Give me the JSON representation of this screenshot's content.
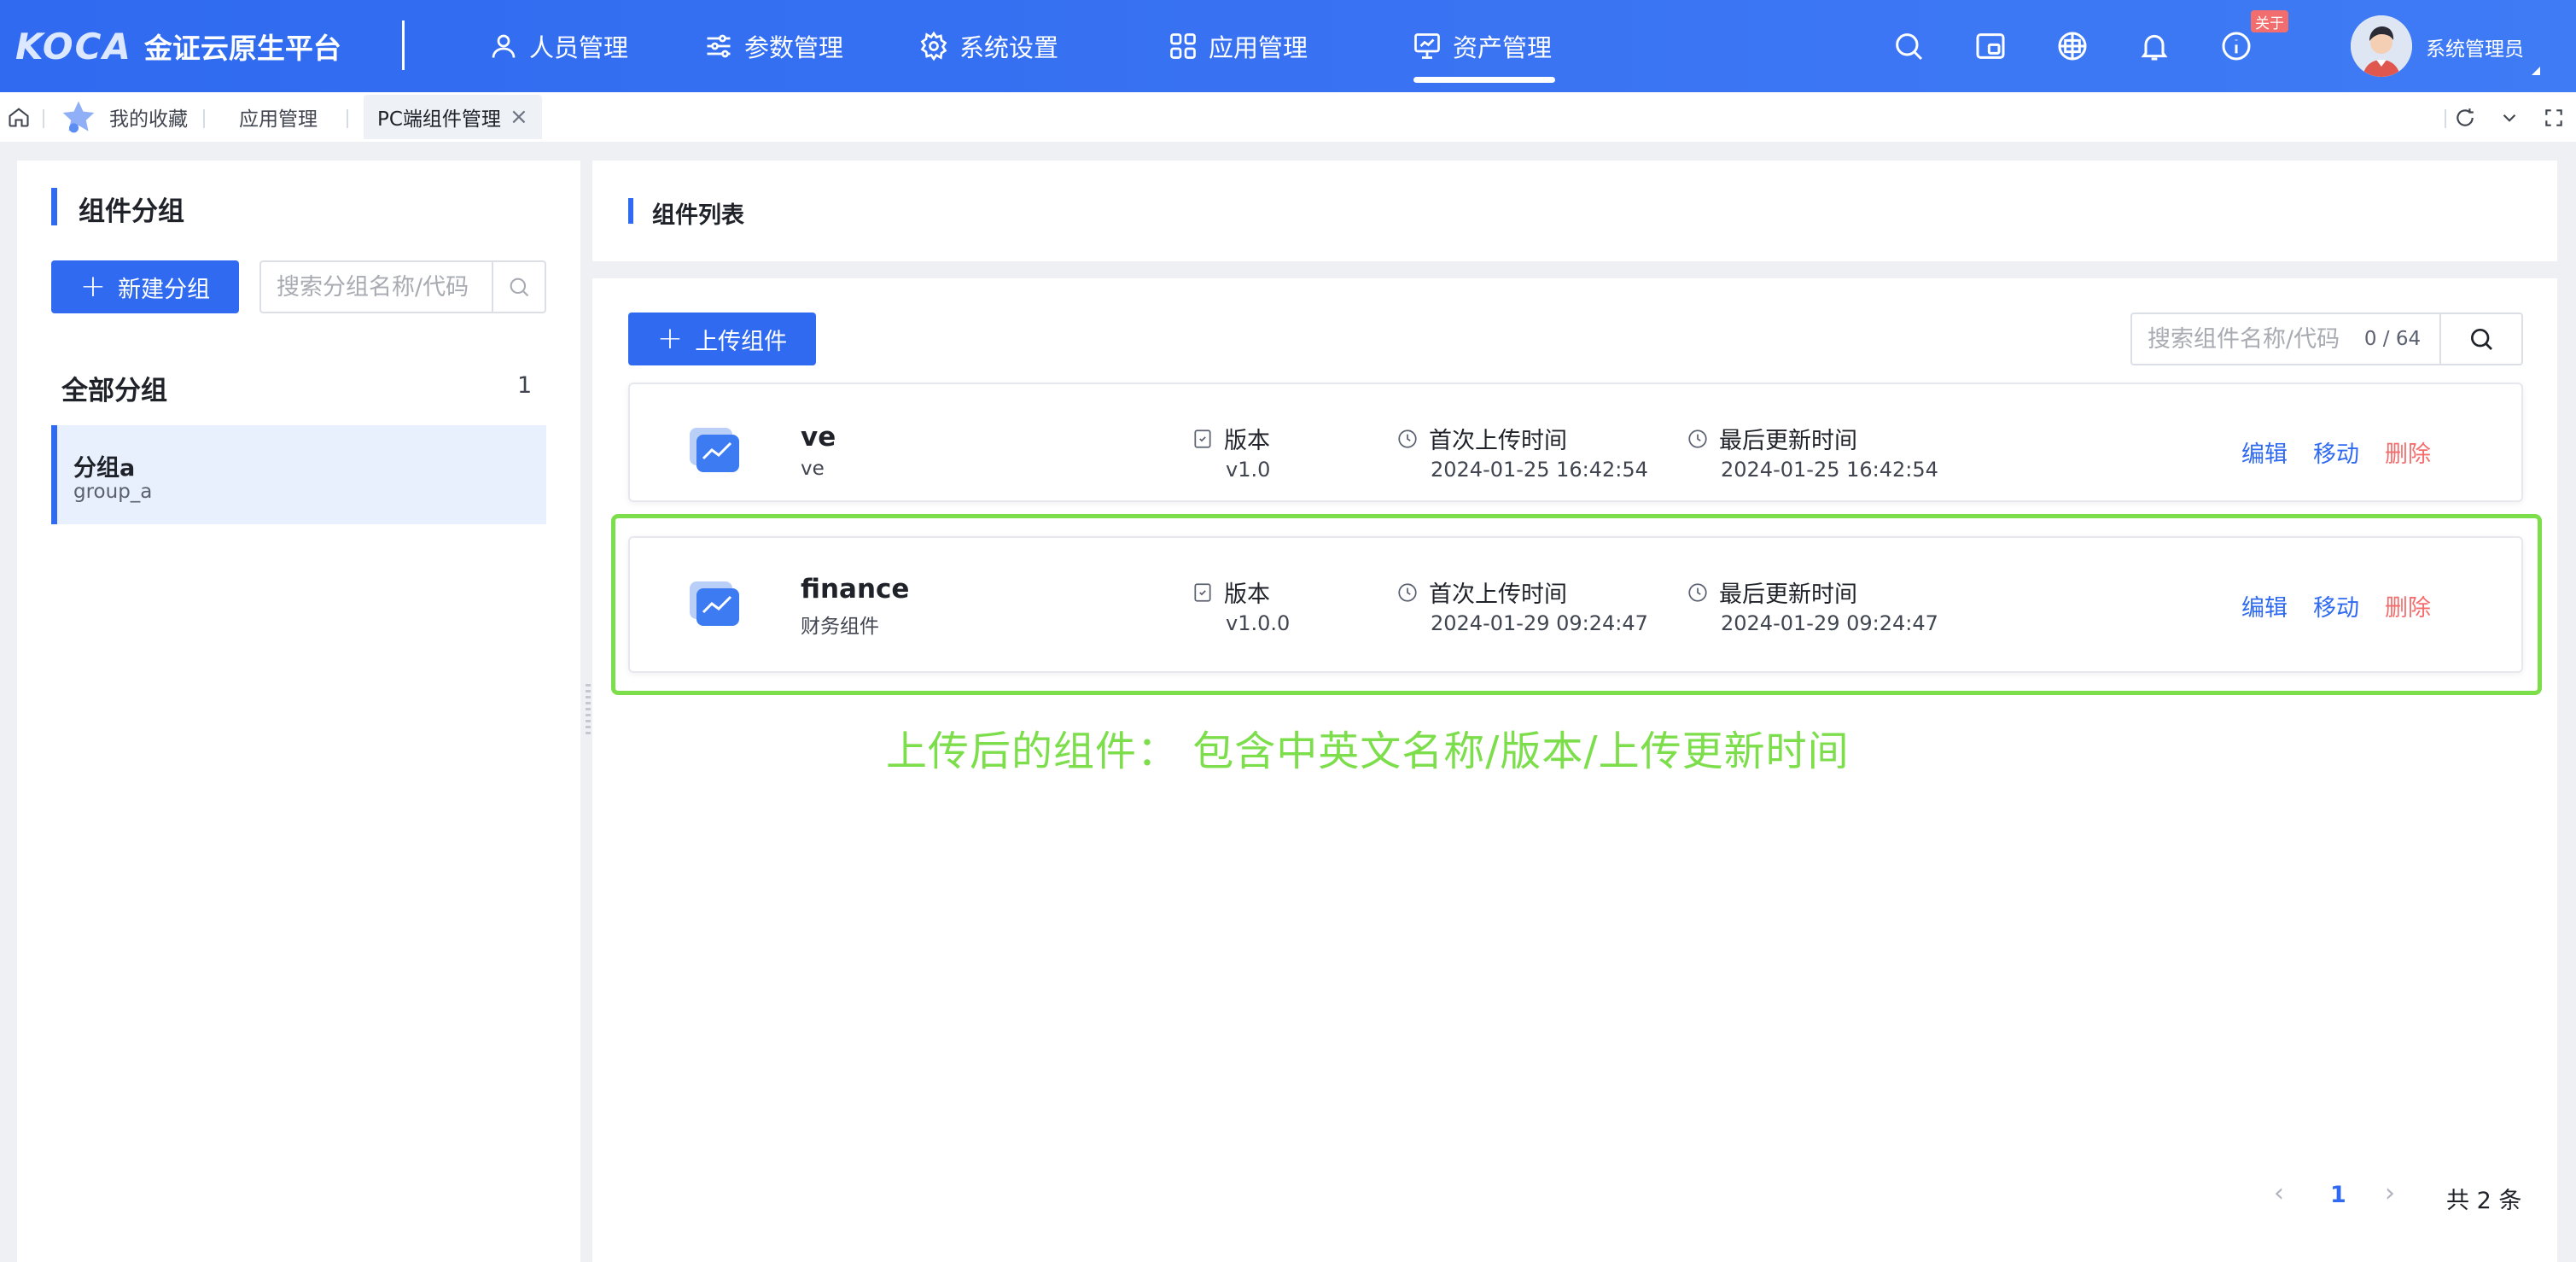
{
  "brand": {
    "logo_mark": "KOCA",
    "platform_name": "金证云原生平台"
  },
  "nav": {
    "items": [
      {
        "label": "人员管理",
        "icon": "user-icon"
      },
      {
        "label": "参数管理",
        "icon": "sliders-icon"
      },
      {
        "label": "系统设置",
        "icon": "gear-icon"
      },
      {
        "label": "应用管理",
        "icon": "grid-icon"
      },
      {
        "label": "资产管理",
        "icon": "monitor-chart-icon",
        "active": true
      }
    ]
  },
  "header_tools": {
    "about_badge": "关于",
    "icons": [
      "search-icon",
      "window-icon",
      "globe-icon",
      "bell-icon",
      "info-icon"
    ],
    "user_name": "系统管理员"
  },
  "tabs": {
    "items": [
      {
        "label": "我的收藏",
        "icon": "star-icon"
      },
      {
        "label": "应用管理"
      },
      {
        "label": "PC端组件管理",
        "active": true,
        "closable": true
      }
    ],
    "tools": [
      "refresh-icon",
      "chevron-down-icon",
      "fullscreen-icon"
    ]
  },
  "groups": {
    "title": "组件分组",
    "new_button": "新建分组",
    "search_placeholder": "搜索分组名称/代码",
    "all_label": "全部分组",
    "all_count": "1",
    "items": [
      {
        "name": "分组a",
        "code": "group_a",
        "selected": true
      }
    ]
  },
  "components": {
    "title": "组件列表",
    "upload_button": "上传组件",
    "search_placeholder": "搜索组件名称/代码",
    "search_counter": "0 / 64",
    "labels": {
      "version": "版本",
      "first_upload": "首次上传时间",
      "last_update": "最后更新时间"
    },
    "actions": {
      "edit": "编辑",
      "move": "移动",
      "delete": "删除"
    },
    "items": [
      {
        "name": "ve",
        "cn_name": "ve",
        "version": "v1.0",
        "first_upload": "2024-01-25 16:42:54",
        "last_update": "2024-01-25 16:42:54"
      },
      {
        "name": "finance",
        "cn_name": "财务组件",
        "version": "v1.0.0",
        "first_upload": "2024-01-29 09:24:47",
        "last_update": "2024-01-29 09:24:47"
      }
    ],
    "annotation": "上传后的组件： 包含中英文名称/版本/上传更新时间"
  },
  "pagination": {
    "current_page": "1",
    "total": "共 2 条"
  },
  "colors": {
    "primary": "#2f6af0",
    "danger": "#f56c6c",
    "annotation": "#7dde4c"
  }
}
